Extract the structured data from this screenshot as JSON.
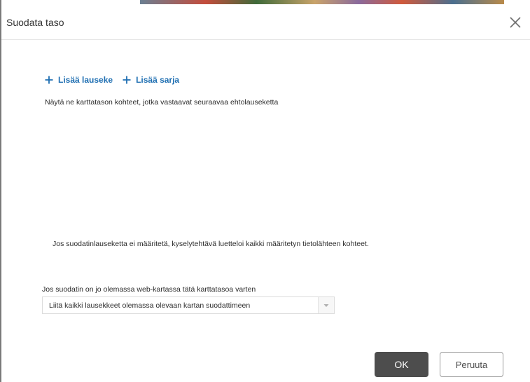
{
  "dialog": {
    "title": "Suodata taso",
    "close_icon": "close-icon"
  },
  "toolbar": {
    "add_expression_label": "Lisää lauseke",
    "add_set_label": "Lisää sarja",
    "plus_icon": "plus-icon",
    "link_color": "#1f6fb2"
  },
  "content": {
    "description": "Näytä ne karttatason kohteet, jotka vastaavat seuraavaa ehtolauseketta",
    "hint": "Jos suodatinlauseketta ei määritetä, kyselytehtävä luetteloi kaikki määritetyn tietolähteen kohteet.",
    "existing_filter_label": "Jos suodatin on jo olemassa web-kartassa tätä karttatasoa varten"
  },
  "existing_filter_select": {
    "value": "Liitä kaikki lausekkeet olemassa olevaan kartan suodattimeen",
    "arrow_icon": "chevron-down-icon"
  },
  "buttons": {
    "ok_label": "OK",
    "cancel_label": "Peruuta",
    "ok_color": "#4d4d4d"
  }
}
